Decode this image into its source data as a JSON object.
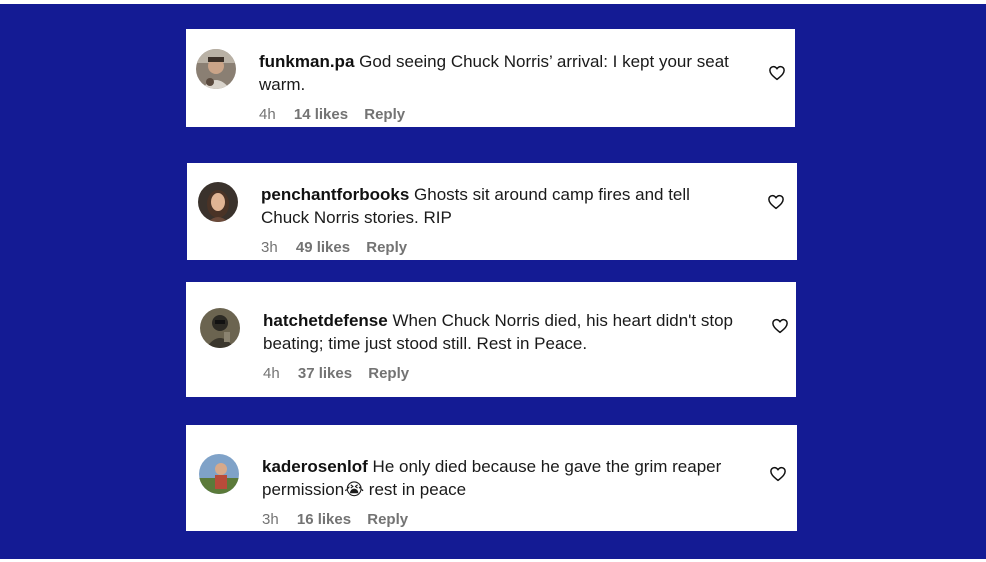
{
  "comments": [
    {
      "username": "funkman.pa",
      "text": "God seeing Chuck Norris’ arrival: I kept your seat warm.",
      "time": "4h",
      "likes": "14 likes",
      "reply": "Reply"
    },
    {
      "username": "penchantforbooks",
      "text": "Ghosts sit around camp fires and tell Chuck Norris stories. RIP",
      "time": "3h",
      "likes": "49 likes",
      "reply": "Reply"
    },
    {
      "username": "hatchetdefense",
      "text": "When Chuck Norris died, his heart didn't stop beating; time just stood still. Rest in Peace.",
      "time": "4h",
      "likes": "37 likes",
      "reply": "Reply"
    },
    {
      "username": "kaderosenlof",
      "text": "He only died because he gave the grim reaper permission😭 rest in peace",
      "time": "3h",
      "likes": "16 likes",
      "reply": "Reply"
    }
  ],
  "colors": {
    "background": "#141b94",
    "card": "#ffffff",
    "meta_text": "#737373"
  },
  "icons": {
    "like": "heart-icon"
  }
}
